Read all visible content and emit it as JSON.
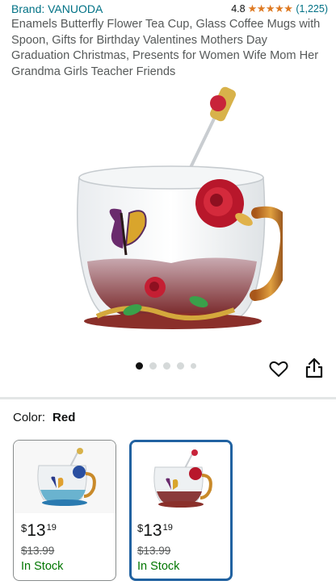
{
  "header": {
    "brand": "Brand: VANUODA",
    "rating_value": "4.8",
    "stars": "★★★★★",
    "rating_count": "(1,225)",
    "title": "Enamels Butterfly Flower Tea Cup, Glass Coffee Mugs with Spoon, Gifts for Birthday Valentines Mothers Day Graduation Christmas, Presents for Women Wife Mom Her Grandma Girls Teacher Friends"
  },
  "gallery": {
    "image_count": 5,
    "active_index": 0
  },
  "actions": {
    "favorite_icon": "heart-icon",
    "share_icon": "share-icon"
  },
  "variation": {
    "label": "Color:",
    "selected": "Red",
    "options": [
      {
        "currency": "$",
        "whole": "13",
        "fraction": "19",
        "list_price": "$13.99",
        "stock": "In Stock"
      },
      {
        "currency": "$",
        "whole": "13",
        "fraction": "19",
        "list_price": "$13.99",
        "stock": "In Stock"
      }
    ]
  },
  "colors": {
    "link": "#007185",
    "stars": "#de7921",
    "in_stock": "#007600",
    "selected_border": "#2162a1"
  }
}
